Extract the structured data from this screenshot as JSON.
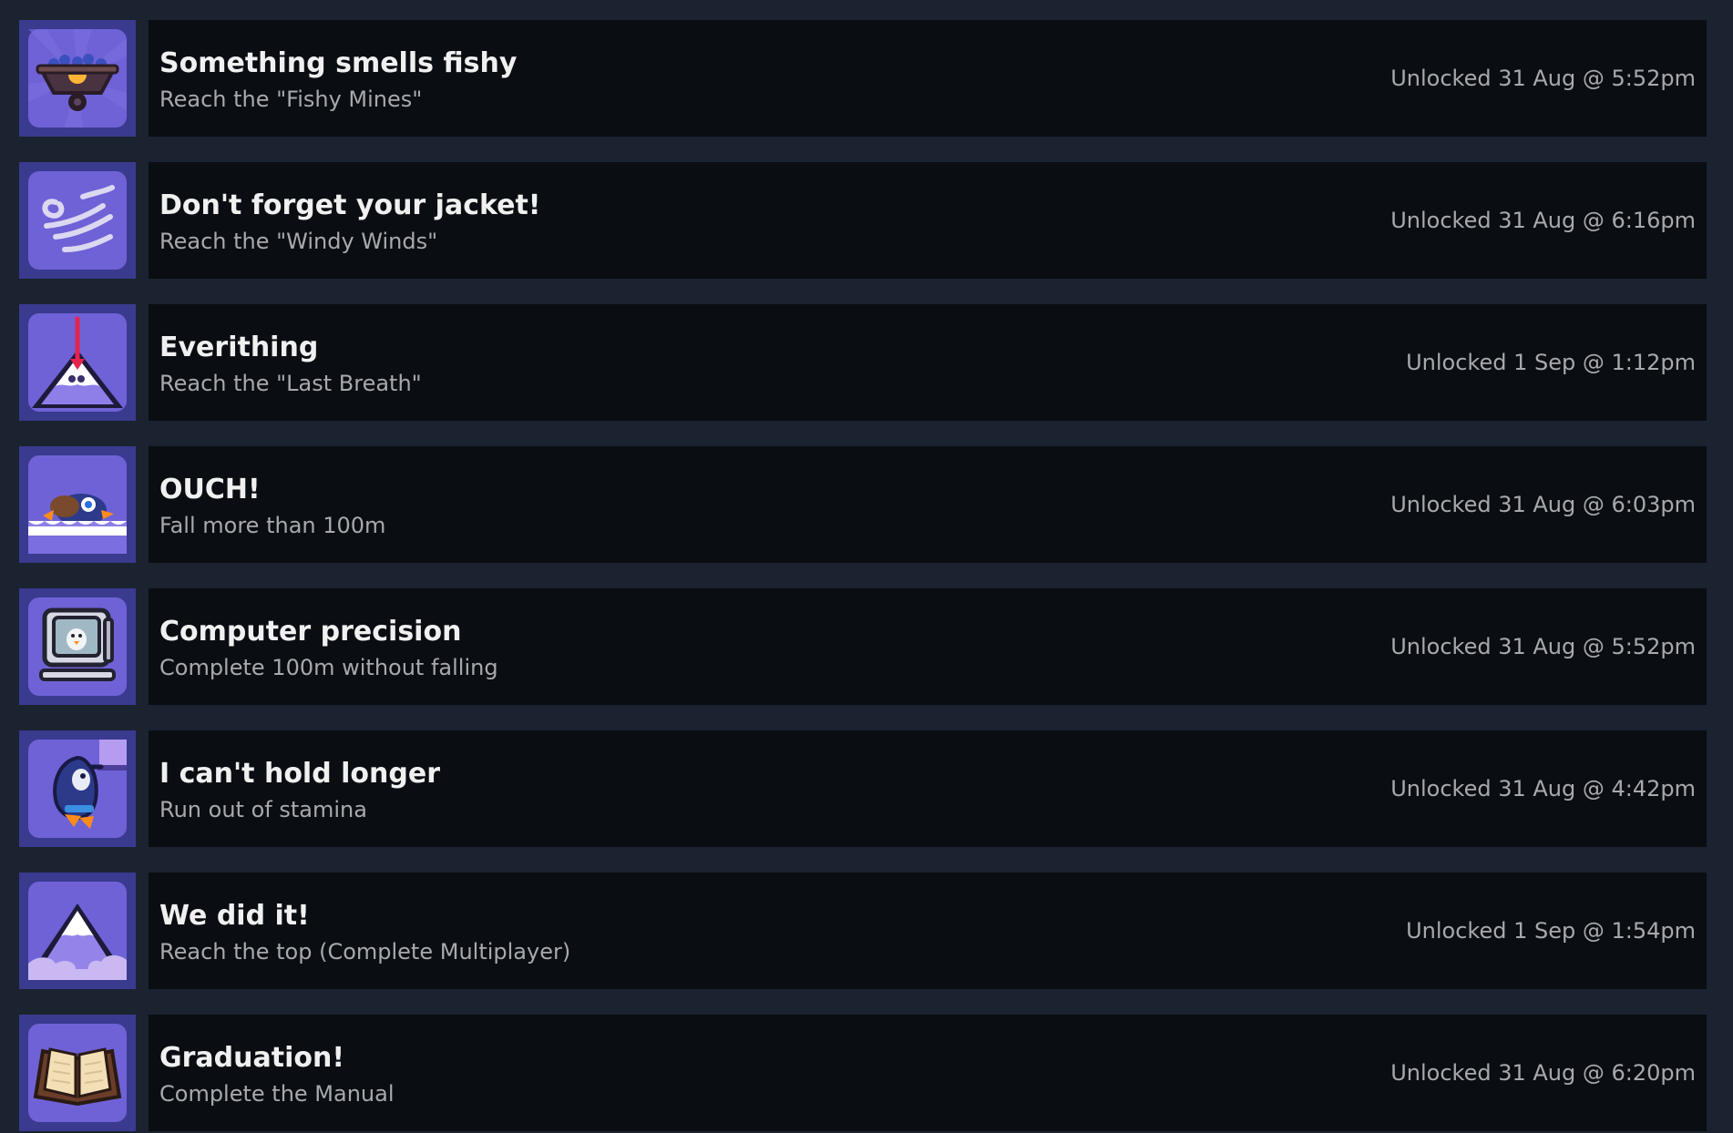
{
  "achievements": [
    {
      "icon": "mine-cart-icon",
      "title": "Something smells fishy",
      "description": "Reach the \"Fishy Mines\"",
      "unlocked": "Unlocked 31 Aug @ 5:52pm"
    },
    {
      "icon": "wind-icon",
      "title": "Don't forget your jacket!",
      "description": "Reach the \"Windy Winds\"",
      "unlocked": "Unlocked 31 Aug @ 6:16pm"
    },
    {
      "icon": "mountain-arrow-icon",
      "title": "Everithing",
      "description": "Reach the \"Last Breath\"",
      "unlocked": "Unlocked 1 Sep @ 1:12pm"
    },
    {
      "icon": "fallen-penguin-icon",
      "title": "OUCH!",
      "description": "Fall more than 100m",
      "unlocked": "Unlocked 31 Aug @ 6:03pm"
    },
    {
      "icon": "computer-penguin-icon",
      "title": "Computer precision",
      "description": "Complete 100m without falling",
      "unlocked": "Unlocked 31 Aug @ 5:52pm"
    },
    {
      "icon": "hanging-penguin-icon",
      "title": "I can't hold longer",
      "description": "Run out of stamina",
      "unlocked": "Unlocked 31 Aug @ 4:42pm"
    },
    {
      "icon": "mountain-summit-icon",
      "title": "We did it!",
      "description": "Reach the top (Complete Multiplayer)",
      "unlocked": "Unlocked 1 Sep @ 1:54pm"
    },
    {
      "icon": "open-book-icon",
      "title": "Graduation!",
      "description": "Complete the Manual",
      "unlocked": "Unlocked 31 Aug @ 6:20pm"
    }
  ],
  "colors": {
    "page_background": "#1b2330",
    "card_background": "#0a0d12",
    "title_text": "#f0f0f0",
    "secondary_text": "#a7a9ad",
    "icon_frame": "#3a3a8f",
    "icon_background": "#6f62d6"
  }
}
